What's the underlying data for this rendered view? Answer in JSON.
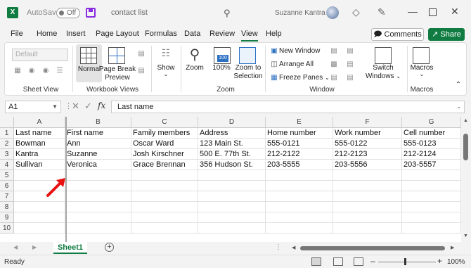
{
  "titlebar": {
    "app_logo": "X",
    "autosave_label": "AutoSave",
    "autosave_state": "Off",
    "doc_title": "contact list",
    "search_icon": "search-icon",
    "user_name": "Suzanne Kantra"
  },
  "menu": {
    "tabs": [
      "File",
      "Home",
      "Insert",
      "Page Layout",
      "Formulas",
      "Data",
      "Review",
      "View",
      "Help"
    ],
    "active_tab": "View",
    "comments_label": "Comments",
    "share_label": "Share"
  },
  "ribbon": {
    "sheet_view": {
      "dropdown_value": "Default",
      "group_label": "Sheet View"
    },
    "workbook_views": {
      "normal": "Normal",
      "page_break_1": "Page Break",
      "page_break_2": "Preview",
      "group_label": "Workbook Views"
    },
    "show": {
      "label": "Show"
    },
    "zoom": {
      "zoom": "Zoom",
      "hundred": "100%",
      "hundred_icon": "100",
      "selection_1": "Zoom to",
      "selection_2": "Selection",
      "group_label": "Zoom"
    },
    "window": {
      "new_window": "New Window",
      "arrange_all": "Arrange All",
      "freeze_panes": "Freeze Panes",
      "switch_1": "Switch",
      "switch_2": "Windows",
      "group_label": "Window"
    },
    "macros": {
      "macros": "Macros",
      "group_label": "Macros"
    }
  },
  "formula_bar": {
    "name_box": "A1",
    "fx": "fx",
    "value": "Last name"
  },
  "grid": {
    "columns": [
      "A",
      "B",
      "C",
      "D",
      "E",
      "F",
      "G"
    ],
    "row_numbers": [
      "1",
      "2",
      "3",
      "4",
      "5",
      "6",
      "7",
      "8",
      "9",
      "10"
    ],
    "rows": [
      [
        "Last name",
        "First name",
        "Family members",
        "Address",
        "Home number",
        "Work number",
        "Cell number"
      ],
      [
        "Bowman",
        "Ann",
        "Oscar Ward",
        "123 Main St.",
        "555-0121",
        "555-0122",
        "555-0123"
      ],
      [
        "Kantra",
        "Suzanne",
        "Josh Kirschner",
        "500 E. 77th St.",
        "212-2122",
        "212-2123",
        "212-2124"
      ],
      [
        "Sullivan",
        "Veronica",
        "Grace Brennan",
        "356 Hudson St.",
        "203-5555",
        "203-5556",
        "203-5557"
      ]
    ]
  },
  "sheets": {
    "active": "Sheet1",
    "add_label": "+"
  },
  "status": {
    "text": "Ready",
    "zoom_pct": "100%"
  },
  "colors": {
    "accent": "#107c41",
    "annotation_arrow": "#e81010"
  }
}
